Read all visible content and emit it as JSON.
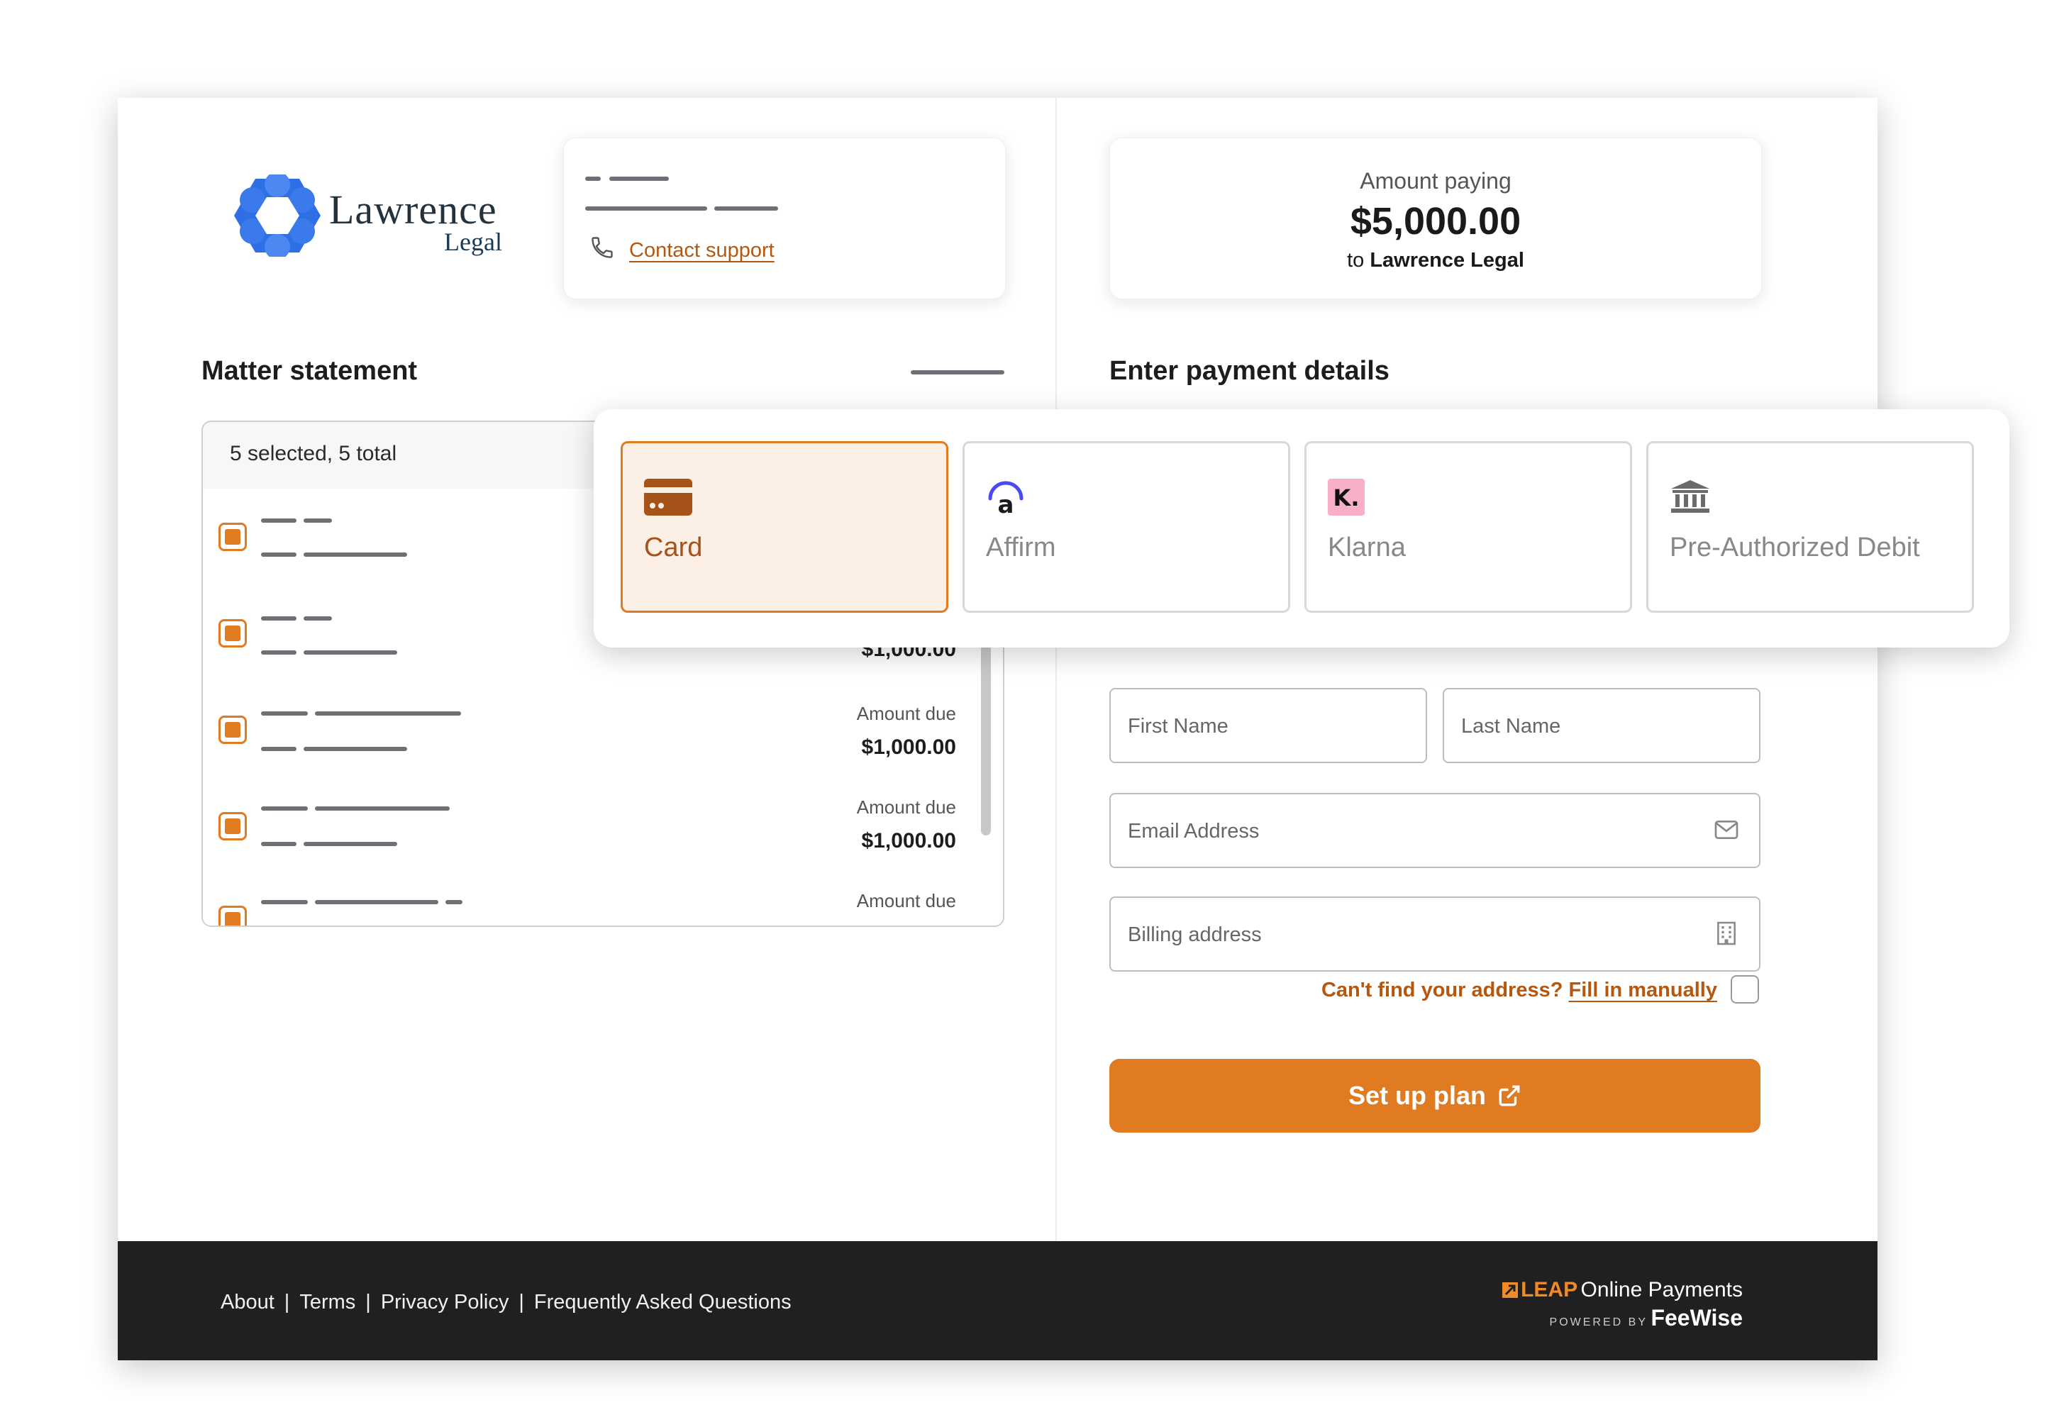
{
  "brand": {
    "name": "Lawrence",
    "sub": "Legal",
    "accent": "#e07b22"
  },
  "support": {
    "link": "Contact support"
  },
  "statement": {
    "title": "Matter statement",
    "summary": "5 selected, 5 total",
    "rows": [
      {
        "label": "",
        "value": ""
      },
      {
        "label": "",
        "value": "$1,000.00"
      },
      {
        "label": "Amount due",
        "value": "$1,000.00"
      },
      {
        "label": "Amount due",
        "value": "$1,000.00"
      },
      {
        "label": "Amount due",
        "value": ""
      }
    ]
  },
  "amount": {
    "label": "Amount paying",
    "value": "$5,000.00",
    "to_prefix": "to",
    "to_name": "Lawrence Legal"
  },
  "payment": {
    "title": "Enter payment details",
    "methods": [
      {
        "label": "Card",
        "icon": "credit-card-icon",
        "selected": true
      },
      {
        "label": "Affirm",
        "icon": "affirm-logo-icon",
        "selected": false
      },
      {
        "label": "Klarna",
        "icon": "klarna-logo-icon",
        "selected": false
      },
      {
        "label": "Pre-Authorized Debit",
        "icon": "bank-icon",
        "selected": false
      }
    ],
    "first_name": "First Name",
    "last_name": "Last Name",
    "email": "Email Address",
    "billing": "Billing address",
    "manual_question": "Can't find your address?",
    "manual_link": "Fill in manually",
    "cta": "Set up plan"
  },
  "footer": {
    "links": [
      "About",
      "Terms",
      "Privacy Policy",
      "Frequently Asked Questions"
    ],
    "brand_leap": "LEAP",
    "brand_product": "Online Payments",
    "powered_by": "POWERED BY",
    "brand_feewise": "FeeWise"
  }
}
